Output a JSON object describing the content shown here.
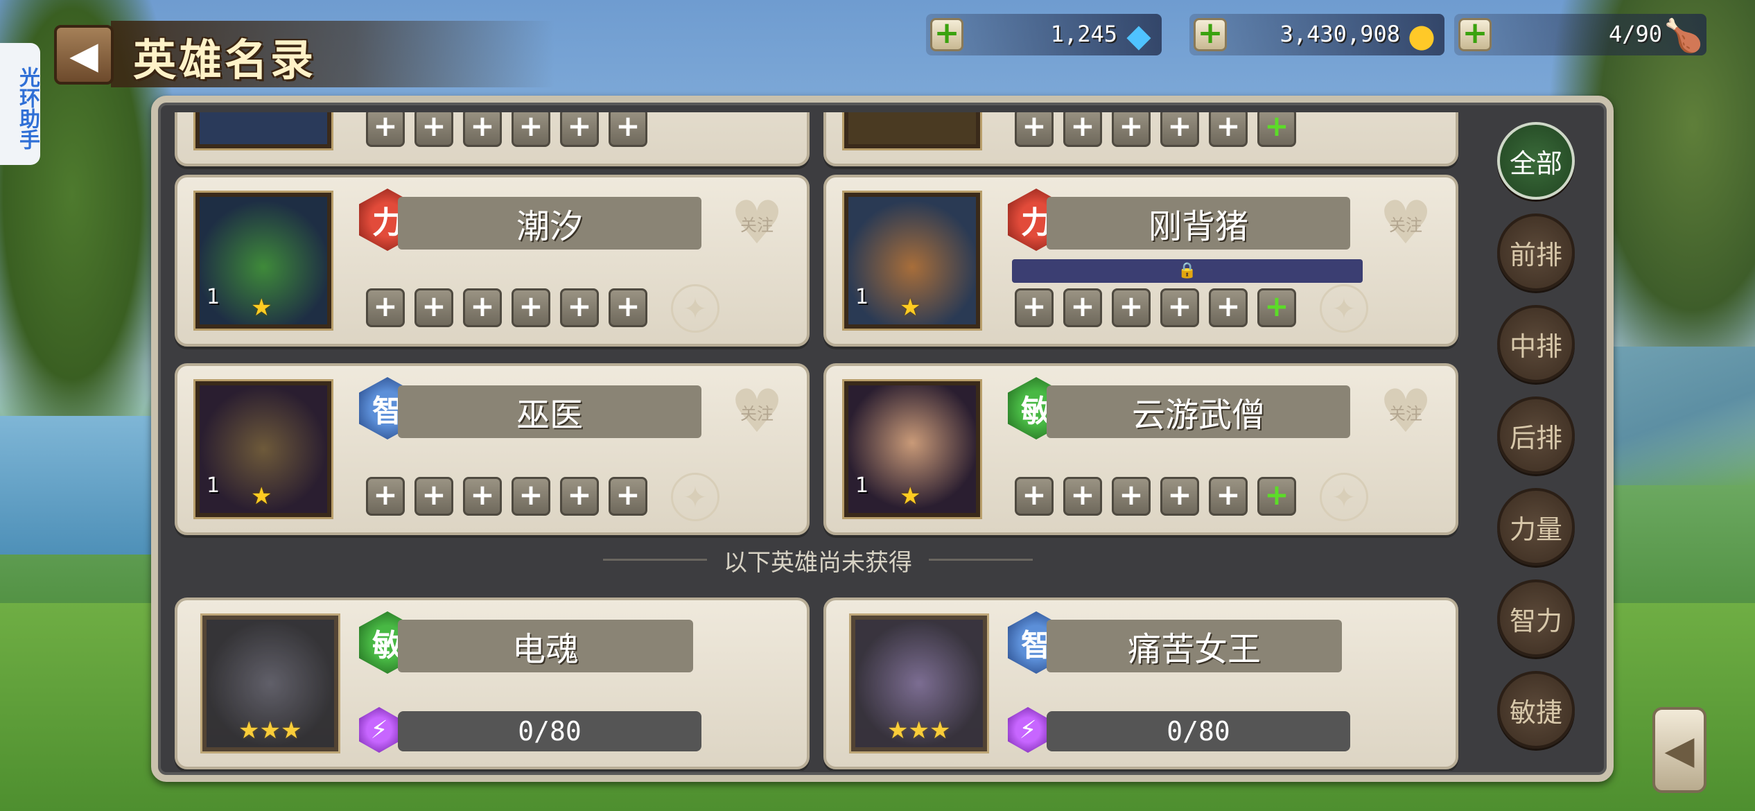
{
  "helper_tab": "光环助手",
  "header": {
    "title": "英雄名录",
    "back_icon": "arrow-left-icon"
  },
  "resources": [
    {
      "id": "diamond",
      "value": "1,245",
      "icon": "diamond-icon"
    },
    {
      "id": "gold",
      "value": "3,430,908",
      "icon": "gold-coins-icon"
    },
    {
      "id": "stamina",
      "value": "4/90",
      "icon": "drumstick-icon"
    }
  ],
  "owned_heroes": [
    {
      "name": "潮汐",
      "attr": "力",
      "level": "1",
      "stars": 1,
      "follow": "关注",
      "last_slot_green": false
    },
    {
      "name": "刚背猪",
      "attr": "力",
      "level": "1",
      "stars": 1,
      "follow": "关注",
      "last_slot_green": true,
      "locked_bar": true
    },
    {
      "name": "巫医",
      "attr": "智",
      "level": "1",
      "stars": 1,
      "follow": "关注",
      "last_slot_green": false
    },
    {
      "name": "云游武僧",
      "attr": "敏",
      "level": "1",
      "stars": 1,
      "follow": "关注",
      "last_slot_green": true
    }
  ],
  "divider_text": "以下英雄尚未获得",
  "unowned_heroes": [
    {
      "name": "电魂",
      "attr": "敏",
      "stars": 3,
      "progress": "0/80"
    },
    {
      "name": "痛苦女王",
      "attr": "智",
      "stars": 3,
      "progress": "0/80"
    }
  ],
  "filters": [
    "全部",
    "前排",
    "中排",
    "后排",
    "力量",
    "智力",
    "敏捷"
  ],
  "active_filter": "全部",
  "colors": {
    "str": "#e24b3a",
    "int": "#5c8fd8",
    "agi": "#48b844",
    "shard": "#c766ff"
  }
}
